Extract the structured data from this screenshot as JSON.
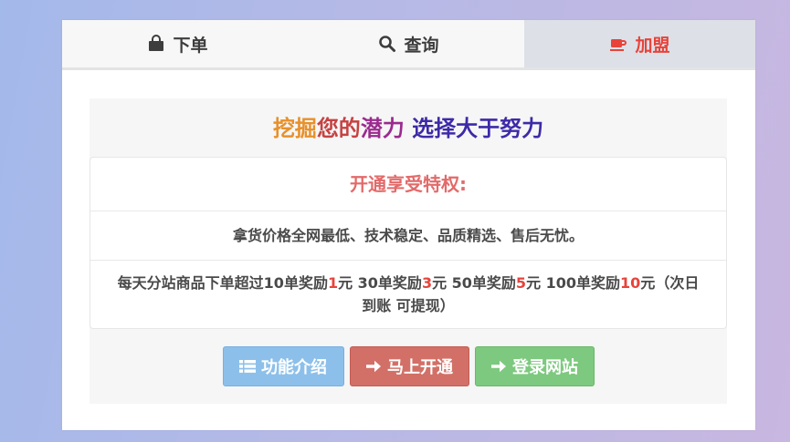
{
  "tabs": [
    {
      "label": "下单",
      "icon": "shopping-bag-icon",
      "active": false
    },
    {
      "label": "查询",
      "icon": "search-icon",
      "active": false
    },
    {
      "label": "加盟",
      "icon": "coffee-cup-icon",
      "active": true
    }
  ],
  "headline": {
    "part1": "挖掘",
    "part2": "您的",
    "part3": "潜力",
    "part4": "选择大于努力"
  },
  "benefits": {
    "title": "开通享受特权:",
    "line1": "拿货价格全网最低、技术稳定、品质精选、售后无忧。",
    "line2": {
      "a": "每天分站商品下单超过10单奖励",
      "n1": "1",
      "b": "元 30单奖励",
      "n2": "3",
      "c": "元 50单奖励",
      "n3": "5",
      "d": "元 100单奖励",
      "n4": "10",
      "e": "元（次日到账 可提现）"
    }
  },
  "buttons": {
    "intro": "功能介绍",
    "open": "马上开通",
    "login": "登录网站"
  },
  "colors": {
    "accent_red": "#e8433a",
    "info": "#8cc0ea",
    "danger": "#d27067",
    "success": "#7dc97f"
  }
}
